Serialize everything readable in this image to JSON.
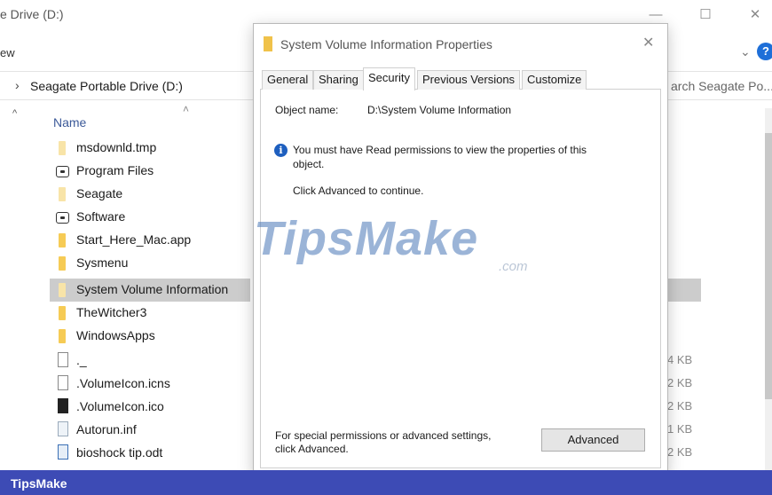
{
  "explorer": {
    "title": "e Drive (D:)",
    "menu_fragment": "ew",
    "address": "Seagate Portable Drive (D:)",
    "search_placeholder": "arch Seagate Po...",
    "column_name": "Name",
    "files": [
      {
        "name": "msdownld.tmp",
        "icon": "folder-faded-icon"
      },
      {
        "name": "Program Files",
        "icon": "drive-icon"
      },
      {
        "name": "Seagate",
        "icon": "folder-faded-icon"
      },
      {
        "name": "Software",
        "icon": "drive-icon"
      },
      {
        "name": "Start_Here_Mac.app",
        "icon": "folder-icon"
      },
      {
        "name": "Sysmenu",
        "icon": "folder-icon"
      },
      {
        "name": "System Volume Information",
        "icon": "folder-faded-icon",
        "selected": true
      },
      {
        "name": "TheWitcher3",
        "icon": "folder-icon"
      },
      {
        "name": "WindowsApps",
        "icon": "folder-icon"
      },
      {
        "name": "._",
        "icon": "file-icon"
      },
      {
        "name": ".VolumeIcon.icns",
        "icon": "file-icon"
      },
      {
        "name": ".VolumeIcon.ico",
        "icon": "file-dark-icon"
      },
      {
        "name": "Autorun.inf",
        "icon": "inf-file-icon"
      },
      {
        "name": "bioshock tip.odt",
        "icon": "odt-file-icon"
      }
    ],
    "sizes": [
      "4 KB",
      "2 KB",
      "2 KB",
      "1 KB",
      "2 KB"
    ]
  },
  "dialog": {
    "title": "System Volume Information Properties",
    "tabs": [
      "General",
      "Sharing",
      "Security",
      "Previous Versions",
      "Customize"
    ],
    "active_tab": "Security",
    "object_name_label": "Object name:",
    "object_name_value": "D:\\System Volume Information",
    "permission_line1": "You must have Read permissions to view the properties of this",
    "permission_line2": "object.",
    "continue_text": "Click Advanced to continue.",
    "special_line1": "For special permissions or advanced settings,",
    "special_line2": "click Advanced.",
    "advanced_button": "Advanced"
  },
  "watermark": {
    "main": "TipsMake",
    "suffix": ".com"
  },
  "footer": {
    "text": "TipsMake"
  },
  "colors": {
    "footer_bg": "#3d4bb5",
    "selection": "#cccccc",
    "info_blue": "#1e5fbf"
  }
}
